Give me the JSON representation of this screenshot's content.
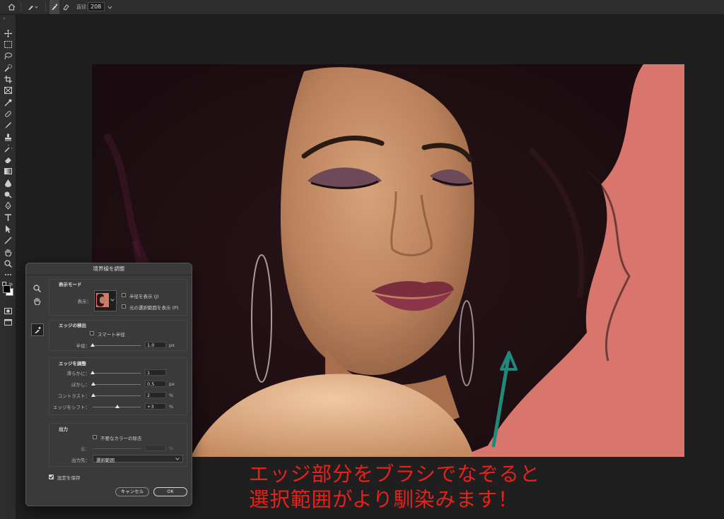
{
  "option_bar": {
    "size_label": "直径：",
    "size_value": "208"
  },
  "toolbar": {
    "tools": [
      "move-tool",
      "marquee-tool",
      "lasso-tool",
      "quick-selection-tool",
      "crop-tool",
      "frame-tool",
      "eyedropper-tool",
      "healing-brush-tool",
      "brush-tool",
      "clone-stamp-tool",
      "history-brush-tool",
      "eraser-tool",
      "gradient-tool",
      "blur-tool",
      "dodge-tool",
      "pen-tool",
      "type-tool",
      "path-selection-tool",
      "line-tool",
      "hand-tool",
      "zoom-tool",
      "more-tools"
    ]
  },
  "dialog": {
    "title": "境界線を調整",
    "view_mode": {
      "heading": "表示モード",
      "view_label": "表示：",
      "show_radius": "半径を表示 (J)",
      "show_original": "元の選択範囲を表示 (P)"
    },
    "edge_detection": {
      "heading": "エッジの検出",
      "smart_radius": "スマート半径",
      "radius_label": "半径：",
      "radius_value": "1.0",
      "radius_unit": "px",
      "radius_level": 0.0
    },
    "adjust_edge": {
      "heading": "エッジを調整",
      "rows": [
        {
          "label": "滑らかに：",
          "value": "1",
          "unit": "",
          "level": 0.0
        },
        {
          "label": "ぼかし：",
          "value": "0.5",
          "unit": "px",
          "level": 0.01
        },
        {
          "label": "コントラスト：",
          "value": "2",
          "unit": "%",
          "level": 0.02
        },
        {
          "label": "エッジをシフト：",
          "value": "+3",
          "unit": "%",
          "level": 0.52
        }
      ]
    },
    "output": {
      "heading": "出力",
      "decontaminate": "不要なカラーの除去",
      "amount_label": "量：",
      "amount_unit": "%",
      "output_to_label": "出力先：",
      "output_to_value": "選択範囲"
    },
    "remember_settings": "設定を保存",
    "cancel_label": "キャンセル",
    "ok_label": "OK"
  },
  "caption": {
    "line1": "エッジ部分をブラシでなぞると",
    "line2": "選択範囲がより馴染みます！"
  },
  "colors": {
    "background_pink": "#d8756c",
    "arrow_teal": "#1f8a7a",
    "caption_red": "#e8211a"
  }
}
